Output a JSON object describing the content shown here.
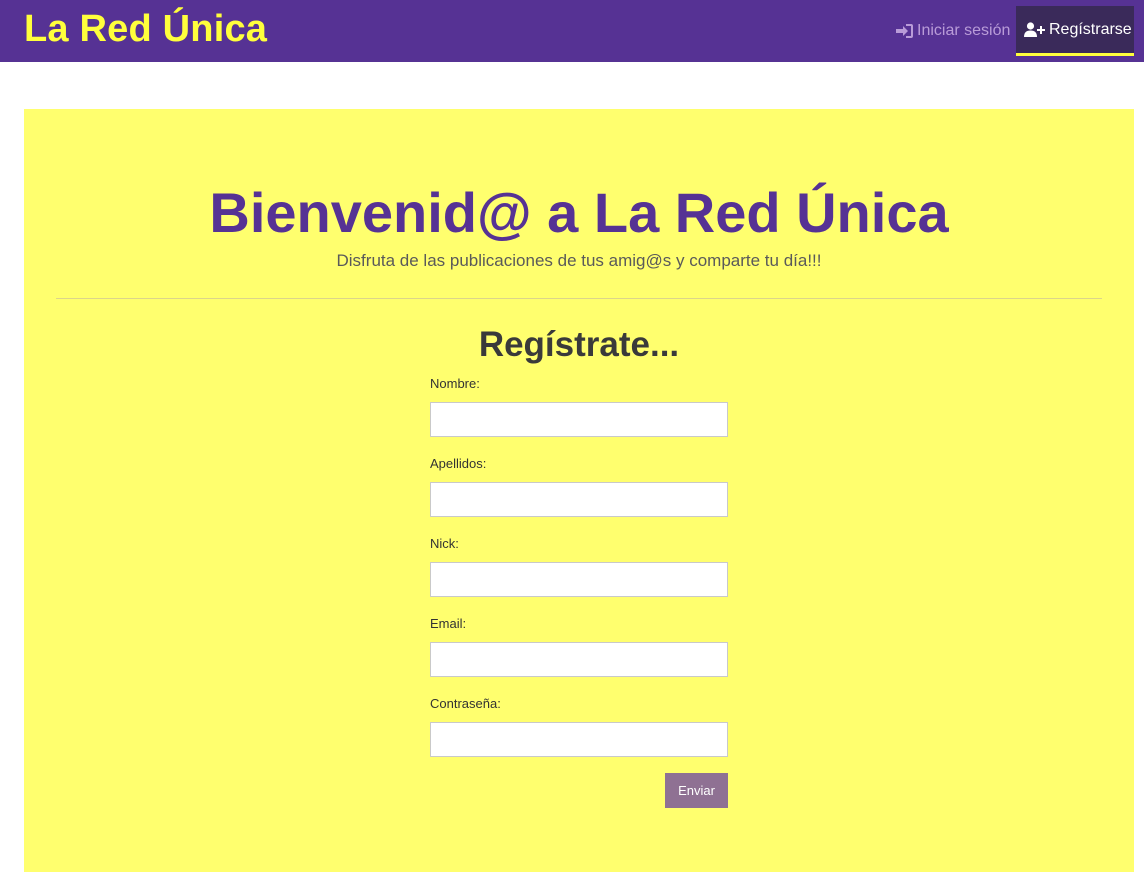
{
  "navbar": {
    "brand": "La Red Única",
    "login_label": "Iniciar sesión",
    "login_icon": "sign-in-icon",
    "register_label": "Regístrarse",
    "register_icon": "user-plus-icon",
    "background_color": "#563294",
    "brand_color": "#ffff3c"
  },
  "hero": {
    "title": "Bienvenid@ a La Red Única",
    "subtitle": "Disfruta de las publicaciones de tus amig@s y comparte tu día!!!",
    "background_color": "#ffff6e"
  },
  "form": {
    "title": "Regístrate...",
    "fields": [
      {
        "label": "Nombre:",
        "value": "",
        "placeholder": ""
      },
      {
        "label": "Apellidos:",
        "value": "",
        "placeholder": ""
      },
      {
        "label": "Nick:",
        "value": "",
        "placeholder": ""
      },
      {
        "label": "Email:",
        "value": "",
        "placeholder": ""
      },
      {
        "label": "Contraseña:",
        "value": "",
        "placeholder": ""
      }
    ],
    "submit_label": "Enviar",
    "submit_color": "#8f7193"
  }
}
